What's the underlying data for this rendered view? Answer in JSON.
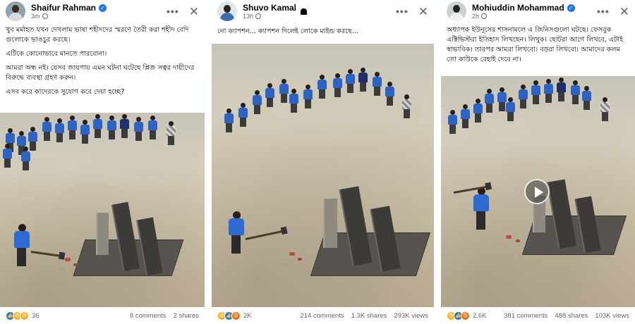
{
  "colors": {
    "verified": "#1877f2",
    "secondary_text": "#65676b",
    "uniform_blue": "#2c63c4"
  },
  "posts": [
    {
      "author": "Shaifur Rahman",
      "verified": true,
      "time": "3m",
      "avatar_icon": "profile-photo-icon",
      "caption": [
        "খুব মর্মাহত যখন দেখলাম ভাষা শহীদদের স্মরণে তৈরী করা শহীদ বেদি গুলোকে ভাঙচুর করছে।",
        "এটিকে কোনোভাবে মানতে পারবোনা।",
        "আমরা অন্ধ নই। যেসব জায়গায় এমন ঘটনা ঘটেছে প্লিজ সত্বর দায়ীদের বিরুদ্ধে ব্যবস্থা গ্রহণ করুন।",
        "এসব করে কাদেরকে সুযোগ করে দেয়া হচ্ছে?"
      ],
      "reaction_icons": [
        "like-reaction-icon",
        "haha-reaction-icon",
        "sad-reaction-icon"
      ],
      "reaction_count": "36",
      "comments": "8 comments",
      "shares": "2 shares",
      "views": ""
    },
    {
      "author": "Shuvo Kamal",
      "verified": false,
      "time": "13h",
      "avatar_icon": "profile-photo-icon",
      "caption": [
        "নো ক্যাপশন... ক্যাপশন দিলেই লোকে মাইন্ড করছে..."
      ],
      "reaction_icons": [
        "sad-reaction-icon",
        "like-reaction-icon",
        "angry-reaction-icon"
      ],
      "reaction_count": "2K",
      "comments": "214 comments",
      "shares": "1.3K shares",
      "views": "293K views"
    },
    {
      "author": "Mohiuddin Mohammad",
      "verified": true,
      "time": "2h",
      "avatar_icon": "profile-photo-icon",
      "caption": [
        "অধ্যাপক ইউনূসের শাসনামলে এ জিনিসগুলো ঘটছে। ফেসবুক এক্টিভিস্টরা ইতিহাস লিখছেন। লিখুক। ছোটরা আগে লিখবে, এটাই স্বাভাবিক। তারপর আমরা লিখবো। বড়রা লিখবো। আমাদের কলম তো কাউকে রেহাই দেবে না।"
      ],
      "reaction_icons": [
        "sad-reaction-icon",
        "like-reaction-icon",
        "angry-reaction-icon"
      ],
      "reaction_count": "2.6K",
      "comments": "381 comments",
      "shares": "488 shares",
      "views": "103K views"
    }
  ]
}
